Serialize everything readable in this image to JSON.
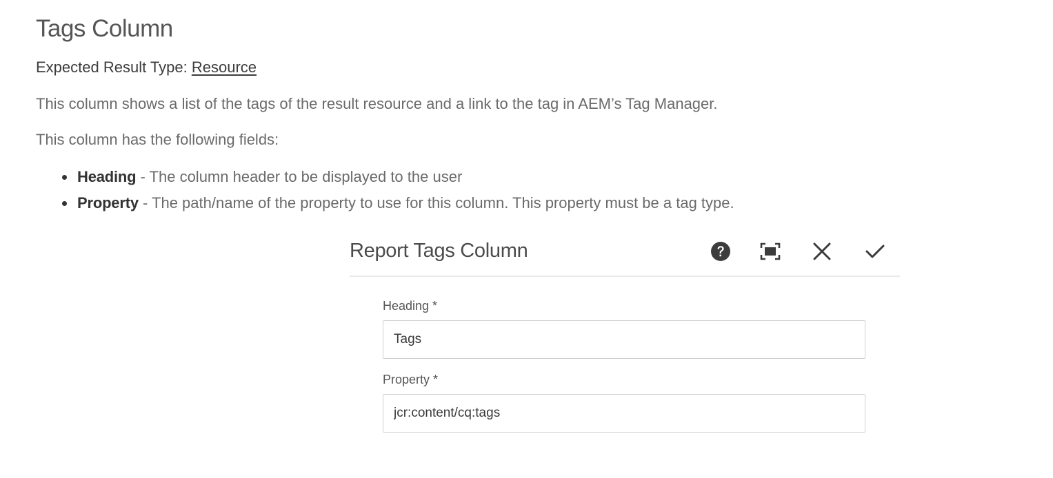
{
  "page": {
    "title": "Tags Column",
    "result_type_label": "Expected Result Type: ",
    "result_type_link": "Resource",
    "description": "This column shows a list of the tags of the result resource and a link to the tag in AEM’s Tag Manager.",
    "fields_intro": "This column has the following fields:",
    "fields": [
      {
        "term": "Heading",
        "description": " - The column header to be displayed to the user"
      },
      {
        "term": "Property",
        "description": " - The path/name of the property to use for this column. This property must be a tag type."
      }
    ]
  },
  "dialog": {
    "title": "Report Tags Column",
    "icons": [
      "help-icon",
      "fullscreen-icon",
      "close-icon",
      "checkmark-icon"
    ],
    "heading_label": "Heading *",
    "heading_value": "Tags",
    "property_label": "Property *",
    "property_value": "jcr:content/cq:tags"
  },
  "colors": {
    "text_light": "#6a6a6a",
    "text_dark": "#333333",
    "divider": "#eaeaea",
    "field_border": "#cfcfcf"
  }
}
